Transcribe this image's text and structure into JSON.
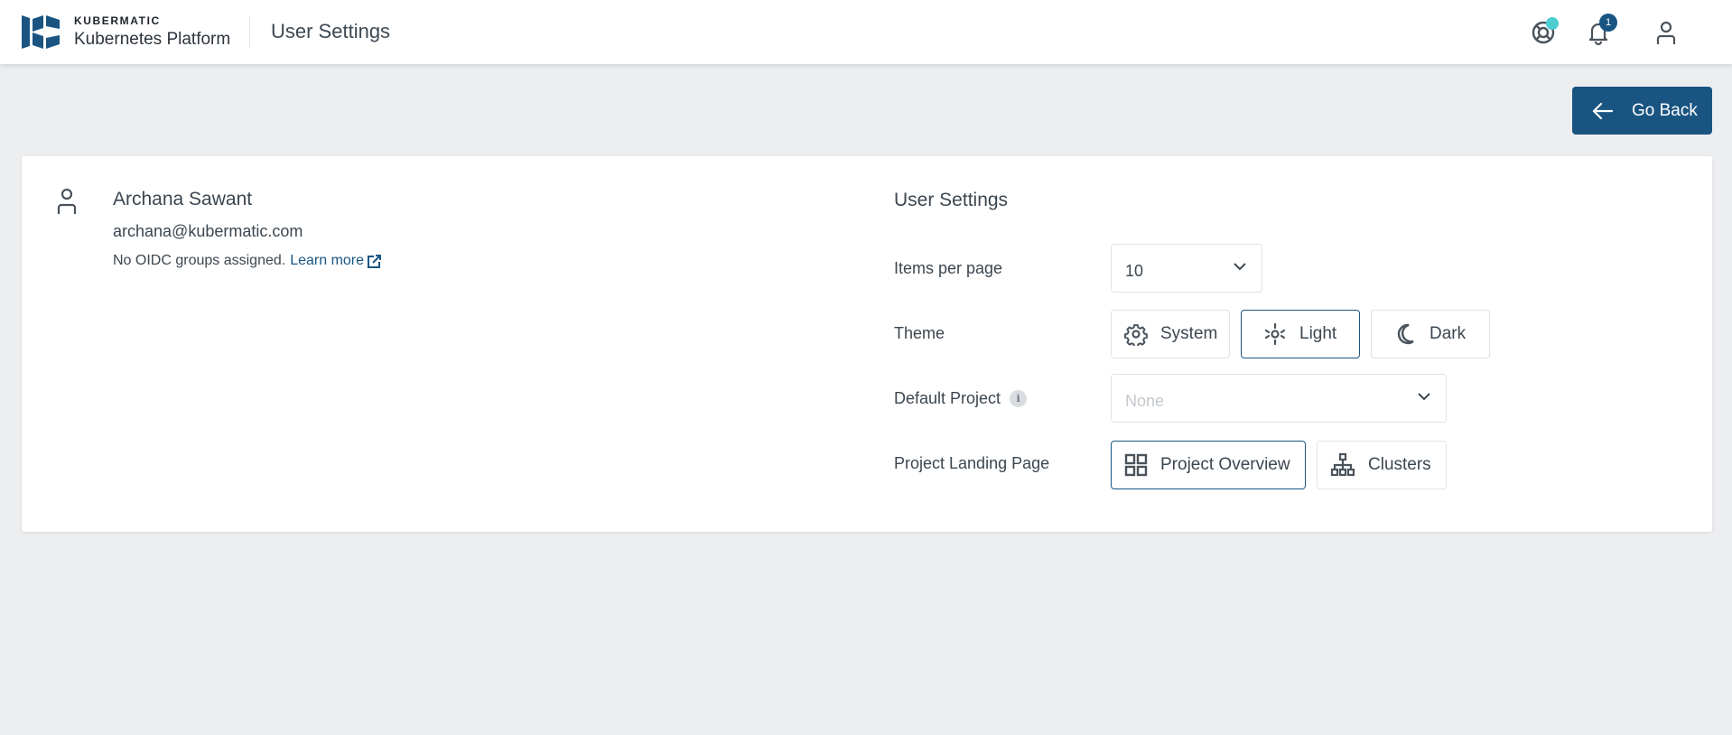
{
  "header": {
    "brand_top": "KUBERMATIC",
    "brand_bottom": "Kubernetes Platform",
    "page_title": "User Settings",
    "icons": {
      "support": "lifebuoy-icon",
      "notifications": "bell-icon",
      "account": "user-icon"
    },
    "notification_count": "1",
    "colors": {
      "brand": "#1a5582",
      "status_dot": "#4ecdd0"
    }
  },
  "actions": {
    "go_back_label": "Go Back"
  },
  "user": {
    "name": "Archana Sawant",
    "email": "archana@kubermatic.com",
    "oidc_text": "No OIDC groups assigned.",
    "learn_more_label": "Learn more"
  },
  "settings": {
    "title": "User Settings",
    "items_per_page": {
      "label": "Items per page",
      "value": "10"
    },
    "theme": {
      "label": "Theme",
      "options": [
        {
          "label": "System",
          "icon": "gear-icon",
          "selected": false
        },
        {
          "label": "Light",
          "icon": "sun-icon",
          "selected": true
        },
        {
          "label": "Dark",
          "icon": "moon-icon",
          "selected": false
        }
      ]
    },
    "default_project": {
      "label": "Default Project",
      "info": "i",
      "placeholder": "None"
    },
    "landing_page": {
      "label": "Project Landing Page",
      "options": [
        {
          "label": "Project Overview",
          "icon": "grid-icon",
          "selected": true
        },
        {
          "label": "Clusters",
          "icon": "hierarchy-icon",
          "selected": false
        }
      ]
    }
  }
}
